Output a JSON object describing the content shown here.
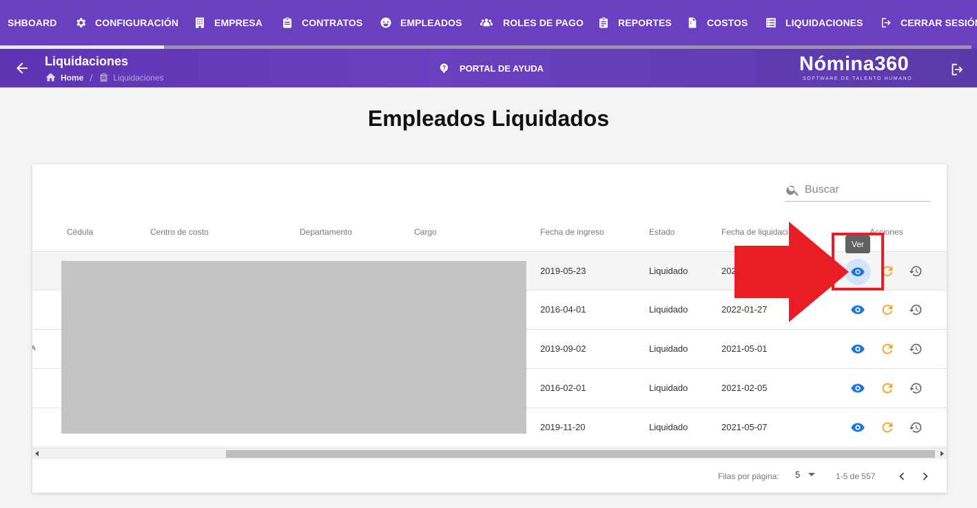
{
  "nav": {
    "items": [
      {
        "label": "SHBOARD",
        "icon": "dashboard-icon"
      },
      {
        "label": "CONFIGURACIÓN",
        "icon": "gear-icon"
      },
      {
        "label": "EMPRESA",
        "icon": "building-icon"
      },
      {
        "label": "CONTRATOS",
        "icon": "clipboard-icon"
      },
      {
        "label": "EMPLEADOS",
        "icon": "employee-face-icon"
      },
      {
        "label": "ROLES DE PAGO",
        "icon": "users-icon"
      },
      {
        "label": "REPORTES",
        "icon": "clipboard-list-icon"
      },
      {
        "label": "COSTOS",
        "icon": "invoice-icon"
      },
      {
        "label": "LIQUIDACIONES",
        "icon": "list-icon"
      },
      {
        "label": "CERRAR SESIÓN",
        "icon": "logout-icon"
      }
    ]
  },
  "header": {
    "title": "Liquidaciones",
    "breadcrumb": {
      "home": "Home",
      "separator": "/",
      "current": "Liquidaciones"
    },
    "help_label": "PORTAL DE AYUDA",
    "brand_name": "Nómina360",
    "brand_tagline": "SOFTWARE DE TALENTO HUMANO"
  },
  "main": {
    "title": "Empleados Liquidados",
    "search_placeholder": "Buscar"
  },
  "table": {
    "columns": {
      "cedula": "Cédula",
      "centro": "Centro de costo",
      "departamento": "Departamento",
      "cargo": "Cargo",
      "ingreso": "Fecha de ingreso",
      "estado": "Estado",
      "liquidacion": "Fecha de liquidaci",
      "acciones": "Acciones"
    },
    "rows": [
      {
        "ingreso": "2019-05-23",
        "estado": "Liquidado",
        "liquidacion": "202"
      },
      {
        "ingreso": "2016-04-01",
        "estado": "Liquidado",
        "liquidacion": "2022-01-27"
      },
      {
        "ingreso": "2019-09-02",
        "estado": "Liquidado",
        "liquidacion": "2021-05-01"
      },
      {
        "ingreso": "2016-02-01",
        "estado": "Liquidado",
        "liquidacion": "2021-02-05"
      },
      {
        "ingreso": "2019-11-20",
        "estado": "Liquidado",
        "liquidacion": "2021-05-07"
      }
    ],
    "tooltip": "Ver",
    "stray_glyph": "A"
  },
  "pagination": {
    "rows_per_page_label": "Filas por página:",
    "rows_per_page": "5",
    "range": "1-5 de 557"
  },
  "colors": {
    "nav_bg": "#6a3fc0",
    "view_icon": "#1a73e8",
    "redo_icon": "#f6a21a",
    "annotation_red": "#ea1c24"
  }
}
